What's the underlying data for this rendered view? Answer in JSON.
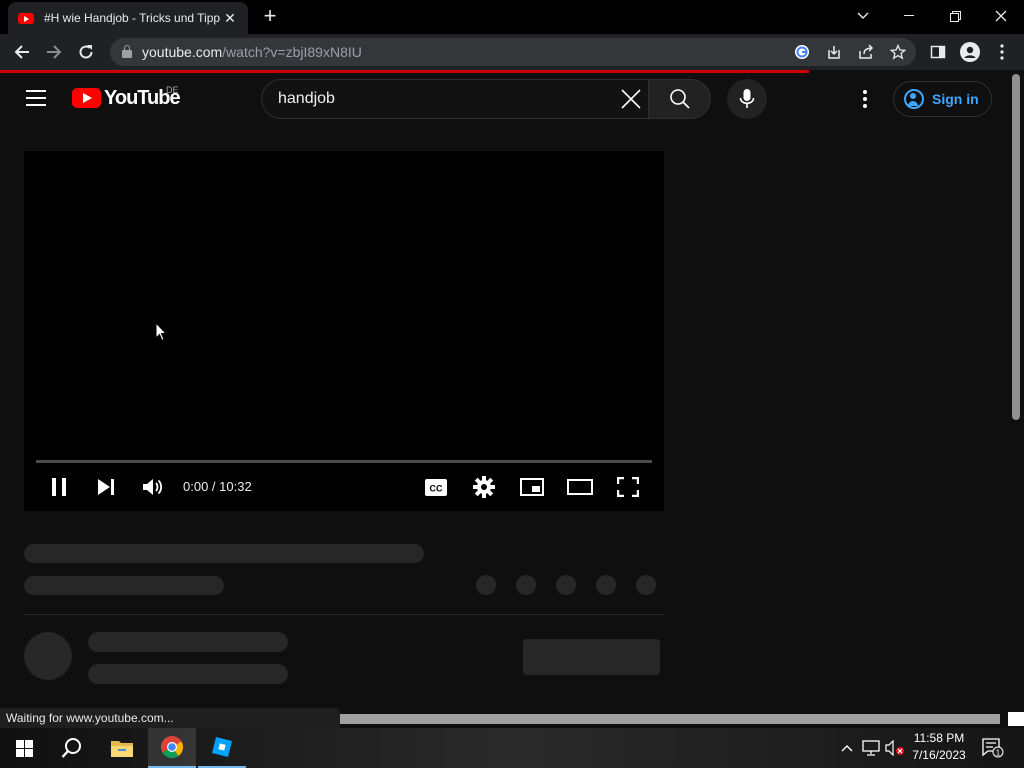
{
  "browser": {
    "tab_title": "#H wie Handjob - Tricks und Tipps",
    "tab_close": "✕",
    "new_tab": "+",
    "url_host": "youtube.com",
    "url_path": "/watch?v=zbjI89xN8IU",
    "status_text": "Waiting for www.youtube.com...",
    "loading_progress": 0.79
  },
  "youtube": {
    "logo_text": "YouTube",
    "country_code": "DE",
    "search_query": "handjob",
    "sign_in_label": "Sign in"
  },
  "player": {
    "time_display": "0:00 / 10:32",
    "state": "playing",
    "progress": 0
  },
  "taskbar": {
    "time": "11:58 PM",
    "date": "7/16/2023",
    "notification_count": "1"
  },
  "colors": {
    "yt_red": "#ff0000",
    "link_blue": "#3ea6ff",
    "background": "#0f0f0f",
    "skeleton": "#272727",
    "load_bar": "#cc0000"
  }
}
